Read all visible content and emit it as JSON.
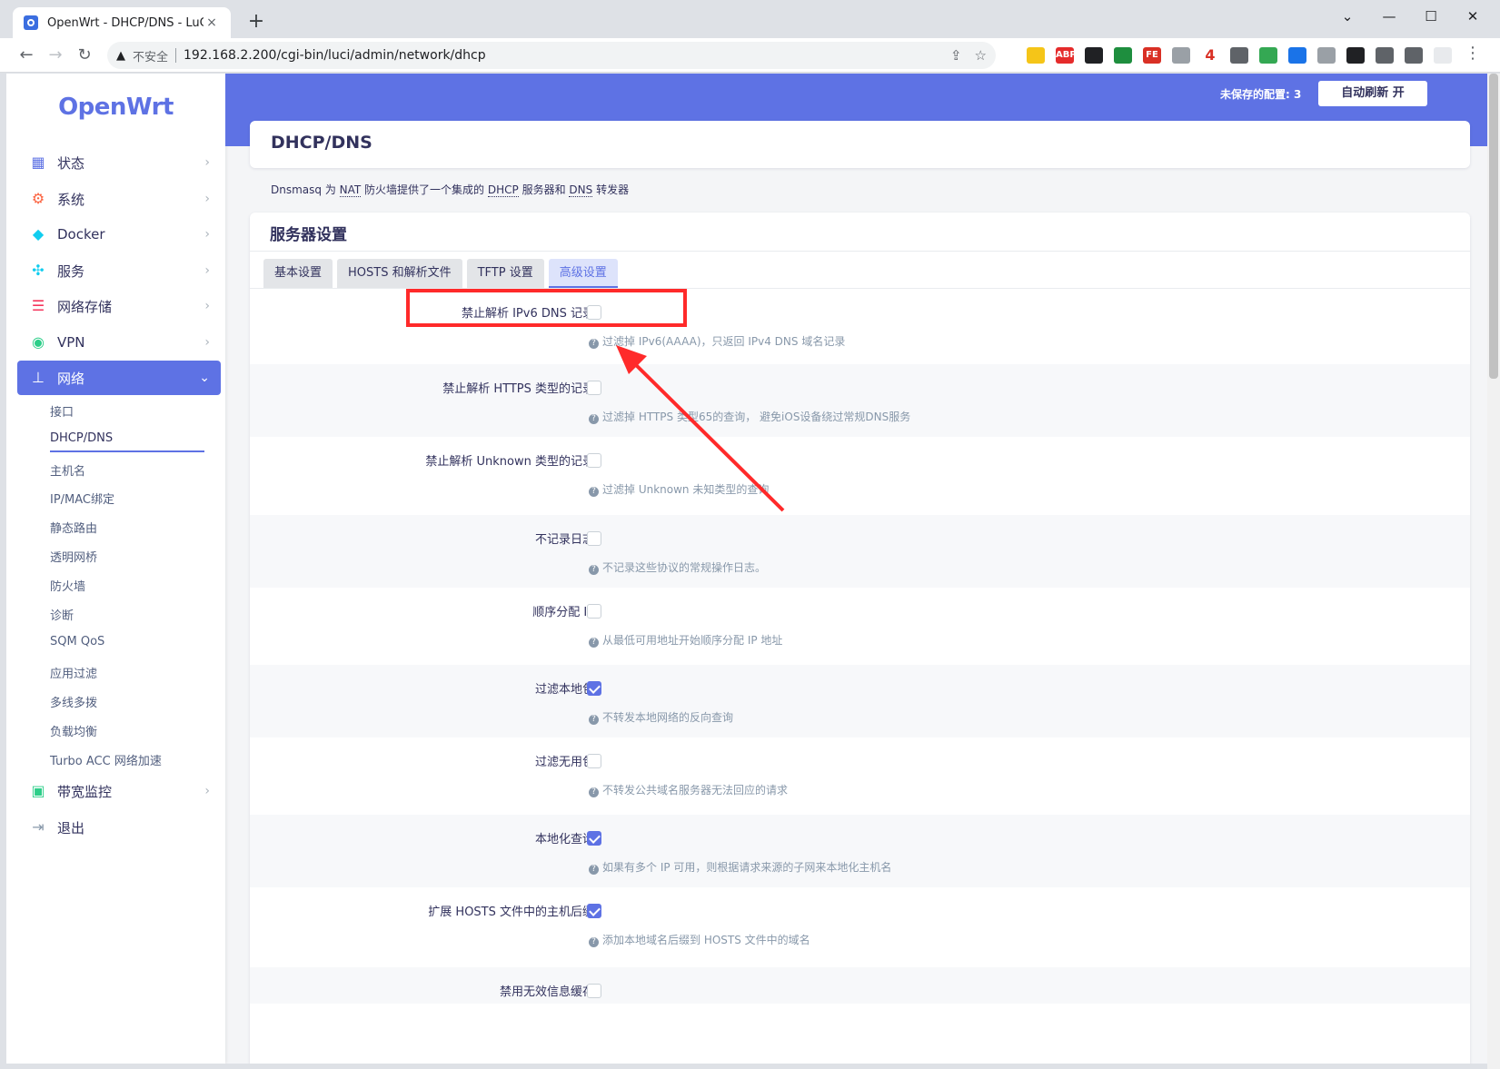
{
  "browser": {
    "tab_title": "OpenWrt - DHCP/DNS - LuCI",
    "tab_close": "×",
    "new_tab": "+",
    "security_label": "不安全",
    "url": "192.168.2.200/cgi-bin/luci/admin/network/dhcp",
    "extensions": [
      {
        "icon": "binoculars-ext-icon",
        "color": "#f5c518",
        "text": ""
      },
      {
        "icon": "abp-ext-icon",
        "color": "#e52b2b",
        "text": "ABP"
      },
      {
        "icon": "spy-ext-icon",
        "color": "#202124",
        "text": ""
      },
      {
        "icon": "tab-ext-icon",
        "color": "#1e8e3e",
        "text": ""
      },
      {
        "icon": "fe-ext-icon",
        "color": "#d93025",
        "text": "FE"
      },
      {
        "icon": "gear-ext-icon",
        "color": "#9aa0a6",
        "text": ""
      },
      {
        "icon": "four-ext-icon",
        "color": "#ffffff",
        "text": "4"
      },
      {
        "icon": "shield-ext-icon",
        "color": "#5f6368",
        "text": ""
      },
      {
        "icon": "globe-ext-icon",
        "color": "#34a853",
        "text": ""
      },
      {
        "icon": "save-ext-icon",
        "color": "#1a73e8",
        "text": ""
      },
      {
        "icon": "image-ext-icon",
        "color": "#9aa0a6",
        "text": ""
      },
      {
        "icon": "play-ext-icon",
        "color": "#202124",
        "text": ""
      },
      {
        "icon": "puzzle-ext-icon",
        "color": "#5f6368",
        "text": ""
      },
      {
        "icon": "sidepanel-ext-icon",
        "color": "#5f6368",
        "text": ""
      },
      {
        "icon": "profile-ext-icon",
        "color": "#e8eaed",
        "text": ""
      }
    ]
  },
  "sidebar": {
    "logo": "OpenWrt",
    "items": [
      {
        "label": "状态",
        "icon": "dashboard-icon",
        "color": "#5e72e4"
      },
      {
        "label": "系统",
        "icon": "gear-icon",
        "color": "#fb6340"
      },
      {
        "label": "Docker",
        "icon": "docker-icon",
        "color": "#11cdef"
      },
      {
        "label": "服务",
        "icon": "services-icon",
        "color": "#11cdef"
      },
      {
        "label": "网络存储",
        "icon": "storage-icon",
        "color": "#f5365c"
      },
      {
        "label": "VPN",
        "icon": "vpn-icon",
        "color": "#2dce89"
      },
      {
        "label": "网络",
        "icon": "network-icon",
        "color": "#ffffff"
      }
    ],
    "sub_items": [
      "接口",
      "DHCP/DNS",
      "主机名",
      "IP/MAC绑定",
      "静态路由",
      "透明网桥",
      "防火墙",
      "诊断",
      "SQM QoS",
      "应用过滤",
      "多线多拨",
      "负载均衡",
      "Turbo ACC 网络加速"
    ],
    "bottom_items": [
      {
        "label": "带宽监控",
        "icon": "monitor-icon",
        "color": "#2dce89"
      },
      {
        "label": "退出",
        "icon": "logout-icon",
        "color": "#8898aa"
      }
    ]
  },
  "header": {
    "unsaved": "未保存的配置: 3",
    "auto_refresh": "自动刷新 开"
  },
  "page": {
    "title": "DHCP/DNS",
    "desc_prefix": "Dnsmasq 为 ",
    "desc_nat": "NAT",
    "desc_mid1": " 防火墙提供了一个集成的 ",
    "desc_dhcp": "DHCP",
    "desc_mid2": " 服务器和 ",
    "desc_dns": "DNS",
    "desc_suffix": " 转发器",
    "section_title": "服务器设置",
    "tabs": [
      "基本设置",
      "HOSTS 和解析文件",
      "TFTP 设置",
      "高级设置"
    ]
  },
  "rows": [
    {
      "label": "禁止解析 IPv6 DNS 记录",
      "checked": false,
      "help": "过滤掉 IPv6(AAAA)，只返回 IPv4 DNS 域名记录"
    },
    {
      "label": "禁止解析 HTTPS 类型的记录",
      "checked": false,
      "help": "过滤掉 HTTPS 类型65的查询， 避免iOS设备绕过常规DNS服务"
    },
    {
      "label": "禁止解析 Unknown 类型的记录",
      "checked": false,
      "help": "过滤掉 Unknown 未知类型的查询"
    },
    {
      "label": "不记录日志",
      "checked": false,
      "help": "不记录这些协议的常规操作日志。"
    },
    {
      "label": "顺序分配 IP",
      "checked": false,
      "help": "从最低可用地址开始顺序分配 IP 地址"
    },
    {
      "label": "过滤本地包",
      "checked": true,
      "help": "不转发本地网络的反向查询"
    },
    {
      "label": "过滤无用包",
      "checked": false,
      "help": "不转发公共域名服务器无法回应的请求"
    },
    {
      "label": "本地化查询",
      "checked": true,
      "help": "如果有多个 IP 可用，则根据请求来源的子网来本地化主机名"
    },
    {
      "label": "扩展 HOSTS 文件中的主机后缀",
      "checked": true,
      "help": "添加本地域名后缀到 HOSTS 文件中的域名"
    },
    {
      "label": "禁用无效信息缓存",
      "checked": false,
      "help": ""
    }
  ],
  "annotation_color": "#ff2a2a"
}
